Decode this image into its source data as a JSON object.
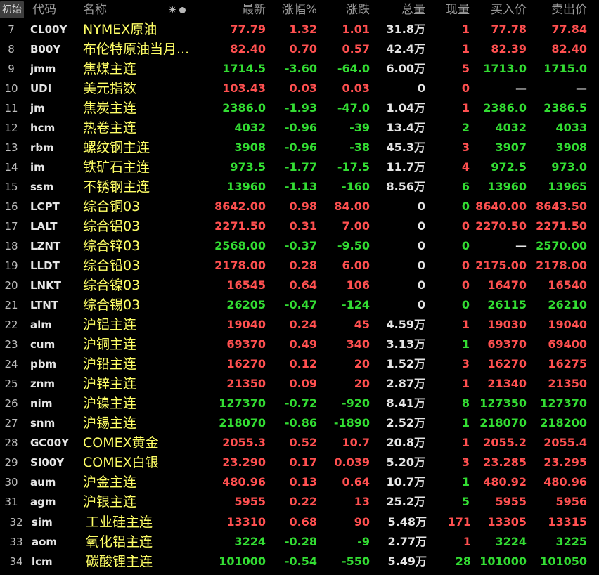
{
  "header": {
    "init_button": "初始",
    "col_code": "代码",
    "col_name": "名称",
    "col_last": "最新",
    "col_pct": "涨幅%",
    "col_chg": "涨跌",
    "col_vol": "总量",
    "col_cur": "现量",
    "col_bid": "买入价",
    "col_ask": "卖出价",
    "icons": [
      "star-icon",
      "dot-icon"
    ]
  },
  "colors": {
    "up": "#ff5050",
    "down": "#33dd33",
    "name": "#ffff66",
    "neutral": "#e6e6e6"
  },
  "rows": [
    {
      "seq": "7",
      "code": "CL00Y",
      "name": "NYMEX原油",
      "last": "77.79",
      "pct": "1.32",
      "chg": "1.01",
      "vol": "31.8万",
      "cur": "1",
      "bid": "77.78",
      "ask": "77.84",
      "dir": "up",
      "cur_dir": "up"
    },
    {
      "seq": "8",
      "code": "B00Y",
      "name": "布伦特原油当月...",
      "last": "82.40",
      "pct": "0.70",
      "chg": "0.57",
      "vol": "42.4万",
      "cur": "1",
      "bid": "82.39",
      "ask": "82.40",
      "dir": "up",
      "cur_dir": "up"
    },
    {
      "seq": "9",
      "code": "jmm",
      "name": "焦煤主连",
      "last": "1714.5",
      "pct": "-3.60",
      "chg": "-64.0",
      "vol": "6.00万",
      "cur": "5",
      "bid": "1713.0",
      "ask": "1715.0",
      "dir": "down",
      "cur_dir": "up"
    },
    {
      "seq": "10",
      "code": "UDI",
      "name": "美元指数",
      "last": "103.43",
      "pct": "0.03",
      "chg": "0.03",
      "vol": "0",
      "cur": "0",
      "bid": "—",
      "ask": "—",
      "dir": "up",
      "cur_dir": "up"
    },
    {
      "seq": "11",
      "code": "jm",
      "name": "焦炭主连",
      "last": "2386.0",
      "pct": "-1.93",
      "chg": "-47.0",
      "vol": "1.04万",
      "cur": "1",
      "bid": "2386.0",
      "ask": "2386.5",
      "dir": "down",
      "cur_dir": "up"
    },
    {
      "seq": "12",
      "code": "hcm",
      "name": "热卷主连",
      "last": "4032",
      "pct": "-0.96",
      "chg": "-39",
      "vol": "13.4万",
      "cur": "2",
      "bid": "4032",
      "ask": "4033",
      "dir": "down",
      "cur_dir": "down"
    },
    {
      "seq": "13",
      "code": "rbm",
      "name": "螺纹钢主连",
      "last": "3908",
      "pct": "-0.96",
      "chg": "-38",
      "vol": "45.3万",
      "cur": "3",
      "bid": "3907",
      "ask": "3908",
      "dir": "down",
      "cur_dir": "up"
    },
    {
      "seq": "14",
      "code": "im",
      "name": "铁矿石主连",
      "last": "973.5",
      "pct": "-1.77",
      "chg": "-17.5",
      "vol": "11.7万",
      "cur": "4",
      "bid": "972.5",
      "ask": "973.0",
      "dir": "down",
      "cur_dir": "up"
    },
    {
      "seq": "15",
      "code": "ssm",
      "name": "不锈钢主连",
      "last": "13960",
      "pct": "-1.13",
      "chg": "-160",
      "vol": "8.56万",
      "cur": "6",
      "bid": "13960",
      "ask": "13965",
      "dir": "down",
      "cur_dir": "down"
    },
    {
      "seq": "16",
      "code": "LCPT",
      "name": "综合铜03",
      "last": "8642.00",
      "pct": "0.98",
      "chg": "84.00",
      "vol": "0",
      "cur": "0",
      "bid": "8640.00",
      "ask": "8643.50",
      "dir": "up",
      "cur_dir": "down"
    },
    {
      "seq": "17",
      "code": "LALT",
      "name": "综合铝03",
      "last": "2271.50",
      "pct": "0.31",
      "chg": "7.00",
      "vol": "0",
      "cur": "0",
      "bid": "2270.50",
      "ask": "2271.50",
      "dir": "up",
      "cur_dir": "up"
    },
    {
      "seq": "18",
      "code": "LZNT",
      "name": "综合锌03",
      "last": "2568.00",
      "pct": "-0.37",
      "chg": "-9.50",
      "vol": "0",
      "cur": "0",
      "bid": "—",
      "ask": "2570.00",
      "dir": "down",
      "cur_dir": "down"
    },
    {
      "seq": "19",
      "code": "LLDT",
      "name": "综合铅03",
      "last": "2178.00",
      "pct": "0.28",
      "chg": "6.00",
      "vol": "0",
      "cur": "0",
      "bid": "2175.00",
      "ask": "2178.00",
      "dir": "up",
      "cur_dir": "up"
    },
    {
      "seq": "20",
      "code": "LNKT",
      "name": "综合镍03",
      "last": "16545",
      "pct": "0.64",
      "chg": "106",
      "vol": "0",
      "cur": "0",
      "bid": "16470",
      "ask": "16540",
      "dir": "up",
      "cur_dir": "up"
    },
    {
      "seq": "21",
      "code": "LTNT",
      "name": "综合锡03",
      "last": "26205",
      "pct": "-0.47",
      "chg": "-124",
      "vol": "0",
      "cur": "0",
      "bid": "26115",
      "ask": "26210",
      "dir": "down",
      "cur_dir": "down"
    },
    {
      "seq": "22",
      "code": "alm",
      "name": "沪铝主连",
      "last": "19040",
      "pct": "0.24",
      "chg": "45",
      "vol": "4.59万",
      "cur": "1",
      "bid": "19030",
      "ask": "19040",
      "dir": "up",
      "cur_dir": "up"
    },
    {
      "seq": "23",
      "code": "cum",
      "name": "沪铜主连",
      "last": "69370",
      "pct": "0.49",
      "chg": "340",
      "vol": "3.13万",
      "cur": "1",
      "bid": "69370",
      "ask": "69400",
      "dir": "up",
      "cur_dir": "down"
    },
    {
      "seq": "24",
      "code": "pbm",
      "name": "沪铅主连",
      "last": "16270",
      "pct": "0.12",
      "chg": "20",
      "vol": "1.52万",
      "cur": "3",
      "bid": "16270",
      "ask": "16275",
      "dir": "up",
      "cur_dir": "up"
    },
    {
      "seq": "25",
      "code": "znm",
      "name": "沪锌主连",
      "last": "21350",
      "pct": "0.09",
      "chg": "20",
      "vol": "2.87万",
      "cur": "1",
      "bid": "21340",
      "ask": "21350",
      "dir": "up",
      "cur_dir": "up"
    },
    {
      "seq": "26",
      "code": "nim",
      "name": "沪镍主连",
      "last": "127370",
      "pct": "-0.72",
      "chg": "-920",
      "vol": "8.41万",
      "cur": "8",
      "bid": "127350",
      "ask": "127370",
      "dir": "down",
      "cur_dir": "down"
    },
    {
      "seq": "27",
      "code": "snm",
      "name": "沪锡主连",
      "last": "218070",
      "pct": "-0.86",
      "chg": "-1890",
      "vol": "2.52万",
      "cur": "1",
      "bid": "218070",
      "ask": "218200",
      "dir": "down",
      "cur_dir": "down"
    },
    {
      "seq": "28",
      "code": "GC00Y",
      "name": "COMEX黄金",
      "last": "2055.3",
      "pct": "0.52",
      "chg": "10.7",
      "vol": "20.8万",
      "cur": "1",
      "bid": "2055.2",
      "ask": "2055.4",
      "dir": "up",
      "cur_dir": "up"
    },
    {
      "seq": "29",
      "code": "SI00Y",
      "name": "COMEX白银",
      "last": "23.290",
      "pct": "0.17",
      "chg": "0.039",
      "vol": "5.20万",
      "cur": "3",
      "bid": "23.285",
      "ask": "23.295",
      "dir": "up",
      "cur_dir": "up"
    },
    {
      "seq": "30",
      "code": "aum",
      "name": "沪金主连",
      "last": "480.96",
      "pct": "0.13",
      "chg": "0.64",
      "vol": "10.7万",
      "cur": "1",
      "bid": "480.92",
      "ask": "480.96",
      "dir": "up",
      "cur_dir": "down"
    },
    {
      "seq": "31",
      "code": "agm",
      "name": "沪银主连",
      "last": "5955",
      "pct": "0.22",
      "chg": "13",
      "vol": "25.2万",
      "cur": "5",
      "bid": "5955",
      "ask": "5956",
      "dir": "up",
      "cur_dir": "down"
    }
  ],
  "pinned_rows": [
    {
      "seq": "32",
      "code": "sim",
      "name": "工业硅主连",
      "last": "13310",
      "pct": "0.68",
      "chg": "90",
      "vol": "5.48万",
      "cur": "171",
      "bid": "13305",
      "ask": "13315",
      "dir": "up",
      "cur_dir": "up"
    },
    {
      "seq": "33",
      "code": "aom",
      "name": "氧化铝主连",
      "last": "3224",
      "pct": "-0.28",
      "chg": "-9",
      "vol": "2.77万",
      "cur": "1",
      "bid": "3224",
      "ask": "3225",
      "dir": "down",
      "cur_dir": "up"
    },
    {
      "seq": "34",
      "code": "lcm",
      "name": "碳酸锂主连",
      "last": "101000",
      "pct": "-0.54",
      "chg": "-550",
      "vol": "5.49万",
      "cur": "28",
      "bid": "101000",
      "ask": "101050",
      "dir": "down",
      "cur_dir": "down"
    }
  ]
}
